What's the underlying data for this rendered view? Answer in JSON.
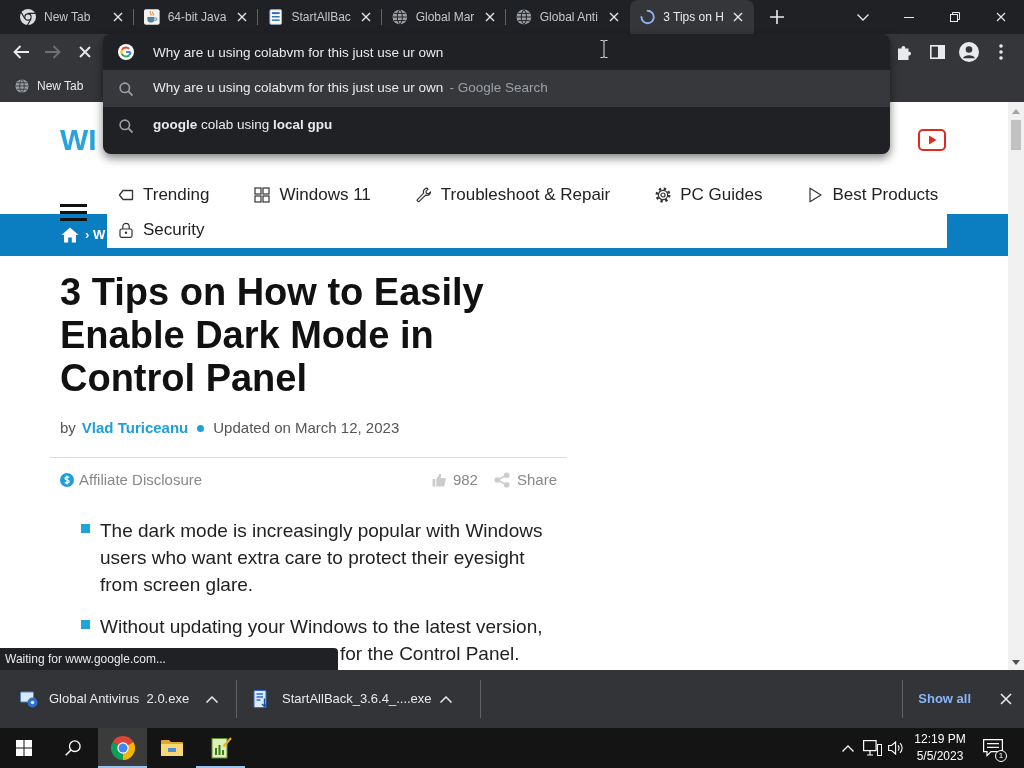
{
  "tabs": [
    {
      "title": "New Tab",
      "selected": false,
      "loading": false
    },
    {
      "title": "64-bit Java",
      "selected": false,
      "loading": false
    },
    {
      "title": "StartAllBac",
      "selected": false,
      "loading": false
    },
    {
      "title": "Global Mar",
      "selected": false,
      "loading": false
    },
    {
      "title": "Global Anti",
      "selected": false,
      "loading": false
    },
    {
      "title": "3 Tips on H",
      "selected": true,
      "loading": true
    }
  ],
  "toolbar": {
    "back": {
      "disabled": false
    },
    "forward": {
      "disabled": true
    },
    "loading": true
  },
  "bookmarks": [
    {
      "title": "New Tab"
    }
  ],
  "omnibox": {
    "value": "Why are u using colabvm for this just use ur own",
    "suggestions": [
      {
        "text": "Why are u using colabvm for this just use ur own",
        "source": "- Google Search",
        "selected": true
      },
      {
        "text": "**google** colab using **local gpu**",
        "selected": false
      }
    ]
  },
  "page": {
    "logo": "WI",
    "breadcrumb": "› W",
    "nav": [
      {
        "label": "Trending"
      },
      {
        "label": "Windows 11"
      },
      {
        "label": "Troubleshoot & Repair"
      },
      {
        "label": "PC Guides"
      },
      {
        "label": "Best Products"
      },
      {
        "label": "Security"
      }
    ],
    "article": {
      "title": "3 Tips on How to Easily Enable Dark Mode in Control Panel",
      "by": "by",
      "author": "Vlad Turiceanu",
      "updated": "Updated on March 12, 2023",
      "affiliate": "Affiliate Disclosure",
      "likes": "982",
      "share": "Share",
      "bullets": [
        {
          "text": "The dark mode is increasingly popular with Windows users who want extra care to protect their eyesight from screen glare."
        },
        {
          "text": "Without updating your Windows to the latest version,",
          "visible_tail": "for the Control Panel."
        }
      ]
    }
  },
  "status_bubble": "Waiting for www.google.com...",
  "downloads": {
    "items": [
      {
        "name": "Global Antivirus  2.0.exe"
      },
      {
        "name": "StartAllBack_3.6.4_....exe"
      }
    ],
    "show_all": "Show all"
  },
  "taskbar": {
    "apps": [
      {
        "selected": true,
        "running": true
      },
      {
        "selected": false,
        "running": false
      },
      {
        "selected": false,
        "running": true
      }
    ],
    "time": "12:19 PM",
    "date": "5/5/2023",
    "notifications": "1"
  }
}
